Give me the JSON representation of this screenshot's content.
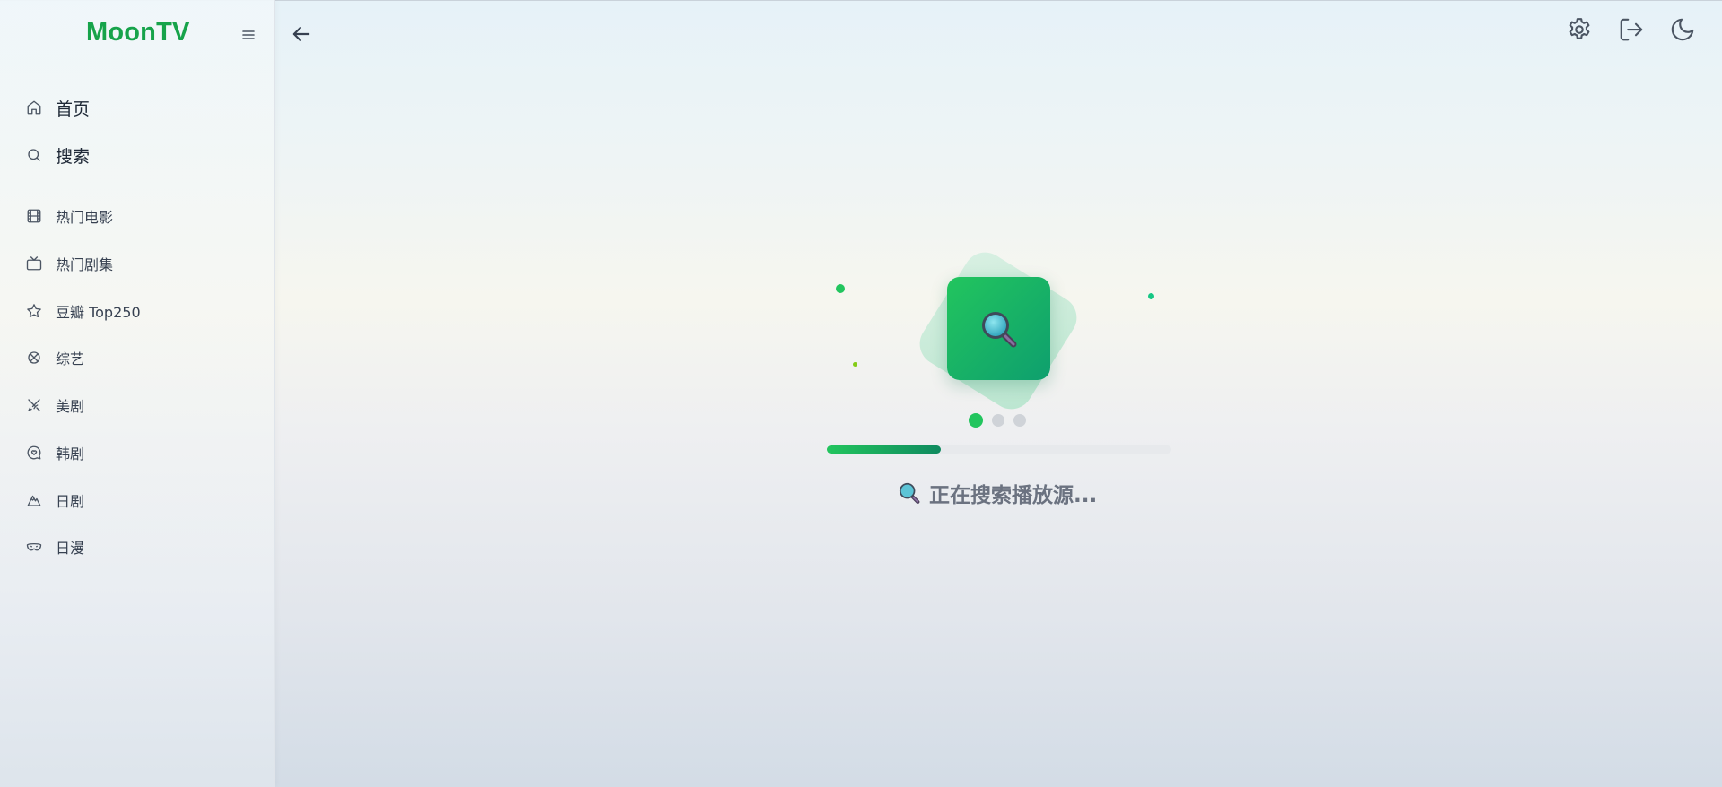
{
  "app": {
    "brand": "MoonTV"
  },
  "sidebar": {
    "primary": [
      {
        "label": "首页",
        "icon": "home-icon"
      },
      {
        "label": "搜索",
        "icon": "search-icon"
      }
    ],
    "items": [
      {
        "label": "热门电影",
        "icon": "film-icon"
      },
      {
        "label": "热门剧集",
        "icon": "tv-icon"
      },
      {
        "label": "豆瓣 Top250",
        "icon": "star-icon"
      },
      {
        "label": "综艺",
        "icon": "clover-icon"
      },
      {
        "label": "美剧",
        "icon": "swords-icon"
      },
      {
        "label": "韩剧",
        "icon": "heart-chat-icon"
      },
      {
        "label": "日剧",
        "icon": "mountain-icon"
      },
      {
        "label": "日漫",
        "icon": "mask-icon"
      }
    ]
  },
  "header": {
    "icons": [
      "back-arrow-icon",
      "settings-icon",
      "logout-icon",
      "moon-icon"
    ]
  },
  "loading": {
    "status": "正在搜索播放源...",
    "progress_fraction": 0.33,
    "active_dot": 0,
    "dot_count": 3
  },
  "colors": {
    "brand": "#16a34a",
    "accent": "#22c55e",
    "accent_dark": "#0e9f6e",
    "text": "#374151",
    "muted": "#6b7280"
  }
}
